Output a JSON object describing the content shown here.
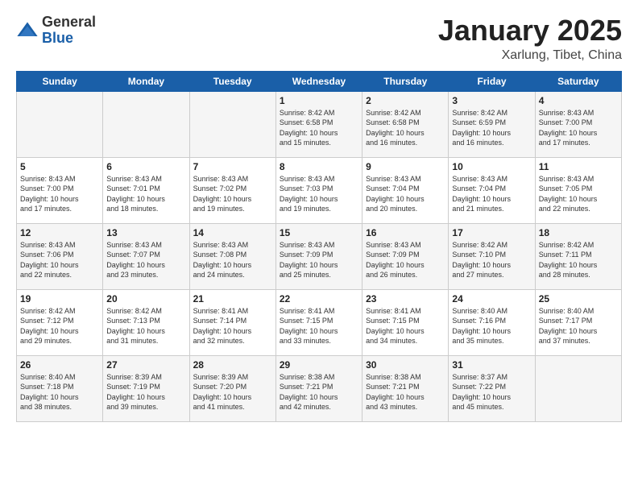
{
  "header": {
    "logo": {
      "line1": "General",
      "line2": "Blue"
    },
    "title": "January 2025",
    "location": "Xarlung, Tibet, China"
  },
  "days_of_week": [
    "Sunday",
    "Monday",
    "Tuesday",
    "Wednesday",
    "Thursday",
    "Friday",
    "Saturday"
  ],
  "weeks": [
    {
      "days": [
        {
          "num": "",
          "detail": ""
        },
        {
          "num": "",
          "detail": ""
        },
        {
          "num": "",
          "detail": ""
        },
        {
          "num": "1",
          "detail": "Sunrise: 8:42 AM\nSunset: 6:58 PM\nDaylight: 10 hours\nand 15 minutes."
        },
        {
          "num": "2",
          "detail": "Sunrise: 8:42 AM\nSunset: 6:58 PM\nDaylight: 10 hours\nand 16 minutes."
        },
        {
          "num": "3",
          "detail": "Sunrise: 8:42 AM\nSunset: 6:59 PM\nDaylight: 10 hours\nand 16 minutes."
        },
        {
          "num": "4",
          "detail": "Sunrise: 8:43 AM\nSunset: 7:00 PM\nDaylight: 10 hours\nand 17 minutes."
        }
      ]
    },
    {
      "days": [
        {
          "num": "5",
          "detail": "Sunrise: 8:43 AM\nSunset: 7:00 PM\nDaylight: 10 hours\nand 17 minutes."
        },
        {
          "num": "6",
          "detail": "Sunrise: 8:43 AM\nSunset: 7:01 PM\nDaylight: 10 hours\nand 18 minutes."
        },
        {
          "num": "7",
          "detail": "Sunrise: 8:43 AM\nSunset: 7:02 PM\nDaylight: 10 hours\nand 19 minutes."
        },
        {
          "num": "8",
          "detail": "Sunrise: 8:43 AM\nSunset: 7:03 PM\nDaylight: 10 hours\nand 19 minutes."
        },
        {
          "num": "9",
          "detail": "Sunrise: 8:43 AM\nSunset: 7:04 PM\nDaylight: 10 hours\nand 20 minutes."
        },
        {
          "num": "10",
          "detail": "Sunrise: 8:43 AM\nSunset: 7:04 PM\nDaylight: 10 hours\nand 21 minutes."
        },
        {
          "num": "11",
          "detail": "Sunrise: 8:43 AM\nSunset: 7:05 PM\nDaylight: 10 hours\nand 22 minutes."
        }
      ]
    },
    {
      "days": [
        {
          "num": "12",
          "detail": "Sunrise: 8:43 AM\nSunset: 7:06 PM\nDaylight: 10 hours\nand 22 minutes."
        },
        {
          "num": "13",
          "detail": "Sunrise: 8:43 AM\nSunset: 7:07 PM\nDaylight: 10 hours\nand 23 minutes."
        },
        {
          "num": "14",
          "detail": "Sunrise: 8:43 AM\nSunset: 7:08 PM\nDaylight: 10 hours\nand 24 minutes."
        },
        {
          "num": "15",
          "detail": "Sunrise: 8:43 AM\nSunset: 7:09 PM\nDaylight: 10 hours\nand 25 minutes."
        },
        {
          "num": "16",
          "detail": "Sunrise: 8:43 AM\nSunset: 7:09 PM\nDaylight: 10 hours\nand 26 minutes."
        },
        {
          "num": "17",
          "detail": "Sunrise: 8:42 AM\nSunset: 7:10 PM\nDaylight: 10 hours\nand 27 minutes."
        },
        {
          "num": "18",
          "detail": "Sunrise: 8:42 AM\nSunset: 7:11 PM\nDaylight: 10 hours\nand 28 minutes."
        }
      ]
    },
    {
      "days": [
        {
          "num": "19",
          "detail": "Sunrise: 8:42 AM\nSunset: 7:12 PM\nDaylight: 10 hours\nand 29 minutes."
        },
        {
          "num": "20",
          "detail": "Sunrise: 8:42 AM\nSunset: 7:13 PM\nDaylight: 10 hours\nand 31 minutes."
        },
        {
          "num": "21",
          "detail": "Sunrise: 8:41 AM\nSunset: 7:14 PM\nDaylight: 10 hours\nand 32 minutes."
        },
        {
          "num": "22",
          "detail": "Sunrise: 8:41 AM\nSunset: 7:15 PM\nDaylight: 10 hours\nand 33 minutes."
        },
        {
          "num": "23",
          "detail": "Sunrise: 8:41 AM\nSunset: 7:15 PM\nDaylight: 10 hours\nand 34 minutes."
        },
        {
          "num": "24",
          "detail": "Sunrise: 8:40 AM\nSunset: 7:16 PM\nDaylight: 10 hours\nand 35 minutes."
        },
        {
          "num": "25",
          "detail": "Sunrise: 8:40 AM\nSunset: 7:17 PM\nDaylight: 10 hours\nand 37 minutes."
        }
      ]
    },
    {
      "days": [
        {
          "num": "26",
          "detail": "Sunrise: 8:40 AM\nSunset: 7:18 PM\nDaylight: 10 hours\nand 38 minutes."
        },
        {
          "num": "27",
          "detail": "Sunrise: 8:39 AM\nSunset: 7:19 PM\nDaylight: 10 hours\nand 39 minutes."
        },
        {
          "num": "28",
          "detail": "Sunrise: 8:39 AM\nSunset: 7:20 PM\nDaylight: 10 hours\nand 41 minutes."
        },
        {
          "num": "29",
          "detail": "Sunrise: 8:38 AM\nSunset: 7:21 PM\nDaylight: 10 hours\nand 42 minutes."
        },
        {
          "num": "30",
          "detail": "Sunrise: 8:38 AM\nSunset: 7:21 PM\nDaylight: 10 hours\nand 43 minutes."
        },
        {
          "num": "31",
          "detail": "Sunrise: 8:37 AM\nSunset: 7:22 PM\nDaylight: 10 hours\nand 45 minutes."
        },
        {
          "num": "",
          "detail": ""
        }
      ]
    }
  ]
}
